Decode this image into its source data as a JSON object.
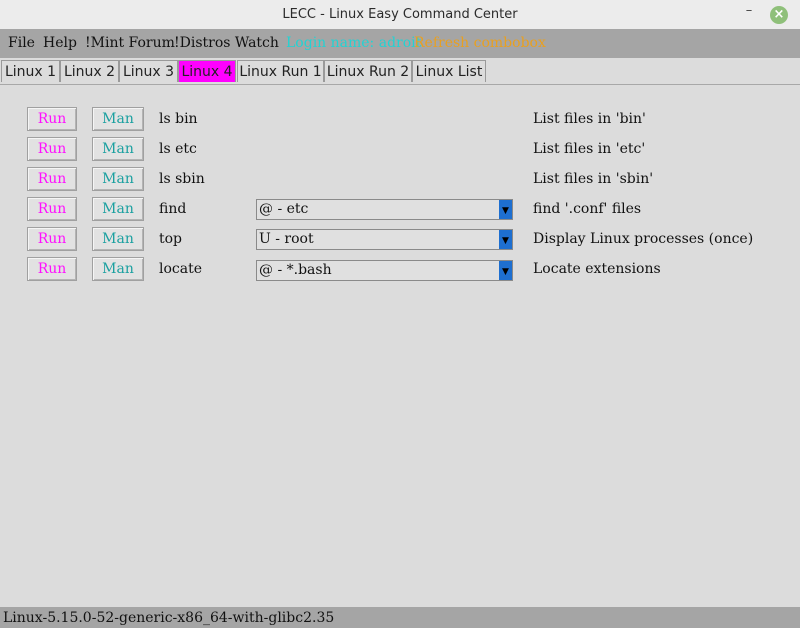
{
  "window": {
    "title": "LECC - Linux Easy Command Center",
    "minimize": "–",
    "close": "×"
  },
  "menu": {
    "file": "File",
    "help": "Help",
    "mint": "!Mint Forum",
    "distros": "!Distros Watch",
    "login": "Login name: adroit",
    "refresh": "Refresh combobox",
    "login_color": "#22d3d3",
    "refresh_color": "#e9a020"
  },
  "tabs": [
    "Linux 1",
    "Linux 2",
    "Linux 3",
    "Linux 4",
    "Linux Run 1",
    "Linux Run 2",
    "Linux List"
  ],
  "active_tab": "Linux 4",
  "rows": [
    {
      "run": "Run",
      "man": "Man",
      "cmd": "ls bin",
      "combo": null,
      "desc": "List files in 'bin'"
    },
    {
      "run": "Run",
      "man": "Man",
      "cmd": "ls etc",
      "combo": null,
      "desc": "List files in 'etc'"
    },
    {
      "run": "Run",
      "man": "Man",
      "cmd": "ls sbin",
      "combo": null,
      "desc": "List files in 'sbin'"
    },
    {
      "run": "Run",
      "man": "Man",
      "cmd": "find",
      "combo": "@ - etc",
      "desc": "find '.conf' files"
    },
    {
      "run": "Run",
      "man": "Man",
      "cmd": "top",
      "combo": "U - root",
      "desc": "Display Linux processes (once)"
    },
    {
      "run": "Run",
      "man": "Man",
      "cmd": "locate",
      "combo": "@ - *.bash",
      "desc": "Locate extensions"
    }
  ],
  "status": "Linux-5.15.0-52-generic-x86_64-with-glibc2.35",
  "icons": {
    "combo_arrow": "chevron-down-icon",
    "close": "close-icon",
    "minimize": "minimize-icon"
  }
}
